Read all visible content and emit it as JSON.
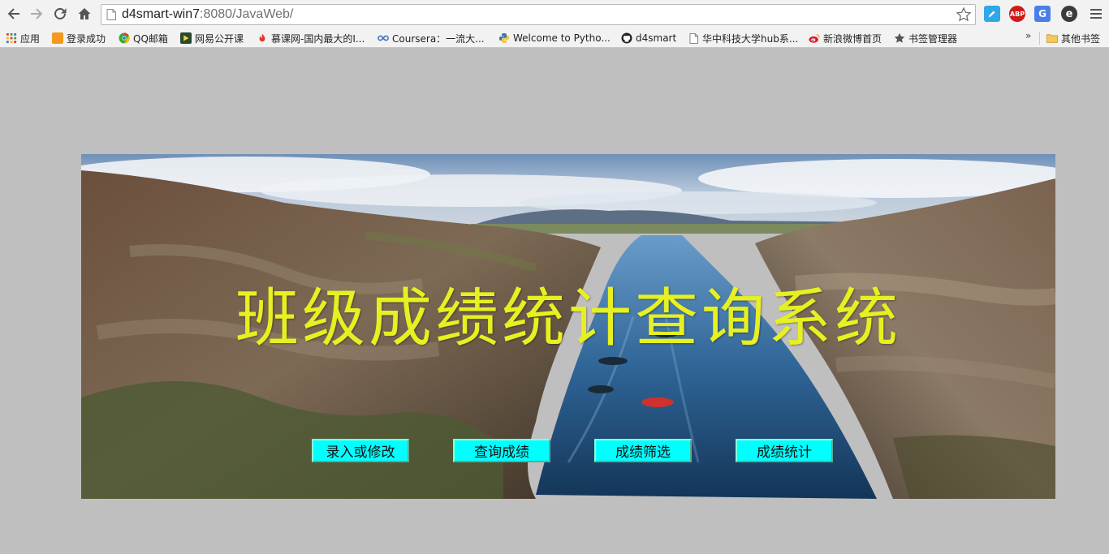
{
  "browser": {
    "url_host": "d4smart-win7",
    "url_rest": ":8080/JavaWeb/",
    "icons": [
      "back-icon",
      "forward-icon",
      "reload-icon",
      "home-icon",
      "page-icon",
      "bookmark-star-icon",
      "menu-icon"
    ],
    "extensions": [
      {
        "name": "pencil-extension-icon",
        "label": "",
        "color": "#2fa8e8"
      },
      {
        "name": "adblock-icon",
        "label": "ABP",
        "color": "#d01a1a"
      },
      {
        "name": "translate-icon",
        "label": "G",
        "color": "#4a7fe8"
      },
      {
        "name": "e-extension-icon",
        "label": "e",
        "color": "#3b3b3b"
      }
    ]
  },
  "bookmarks": {
    "items": [
      {
        "label": "应用",
        "icon": "apps-grid-icon"
      },
      {
        "label": "登录成功",
        "icon": "bookmark-orange-icon"
      },
      {
        "label": "QQ邮箱",
        "icon": "bookmark-chrome-icon"
      },
      {
        "label": "网易公开课",
        "icon": "bookmark-play-icon"
      },
      {
        "label": "慕课网-国内最大的I...",
        "icon": "bookmark-flame-icon"
      },
      {
        "label": "Coursera：一流大...",
        "icon": "bookmark-infinity-icon"
      },
      {
        "label": "Welcome to Pytho...",
        "icon": "python-icon"
      },
      {
        "label": "d4smart",
        "icon": "github-icon"
      },
      {
        "label": "华中科技大学hub系...",
        "icon": "page-icon"
      },
      {
        "label": "新浪微博首页",
        "icon": "weibo-icon"
      },
      {
        "label": "书签管理器",
        "icon": "star-icon"
      }
    ],
    "overflow": "»",
    "other": {
      "label": "其他书签",
      "icon": "folder-icon"
    }
  },
  "page": {
    "title": "班级成绩统计查询系统",
    "buttons": [
      {
        "name": "entry-or-edit-button",
        "label": "录入或修改"
      },
      {
        "name": "query-scores-button",
        "label": "查询成绩"
      },
      {
        "name": "filter-scores-button",
        "label": "成绩筛选"
      },
      {
        "name": "score-statistics-button",
        "label": "成绩统计"
      }
    ]
  },
  "colors": {
    "page_bg": "#bfbfbf",
    "title": "#e7f020",
    "button_bg": "#00ffff"
  }
}
